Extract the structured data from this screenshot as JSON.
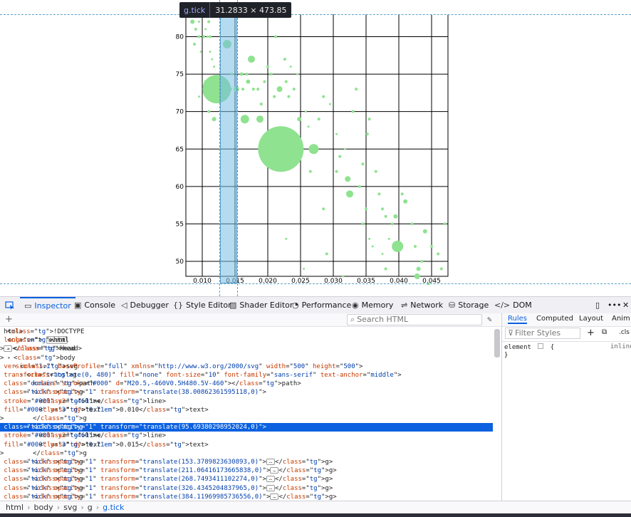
{
  "tooltip": {
    "tag": "g.tick",
    "dims": "31.2833 × 473.85"
  },
  "chart_data": {
    "type": "scatter",
    "x_ticks": [
      "0.010",
      "0.015",
      "0.020",
      "0.025",
      "0.030",
      "0.035",
      "0.040",
      "0.045"
    ],
    "y_ticks": [
      "50",
      "55",
      "60",
      "65",
      "70",
      "75",
      "80"
    ],
    "xlim": [
      0.0075,
      0.0475
    ],
    "ylim": [
      48,
      83
    ],
    "color": "#8fe28f",
    "points": [
      [
        0.0085,
        82,
        3
      ],
      [
        0.0088,
        83,
        2
      ],
      [
        0.0095,
        82,
        1.5
      ],
      [
        0.0105,
        81,
        1.5
      ],
      [
        0.011,
        82,
        2
      ],
      [
        0.009,
        81,
        2
      ],
      [
        0.0095,
        80,
        2
      ],
      [
        0.0102,
        80,
        2
      ],
      [
        0.0108,
        80,
        1.5
      ],
      [
        0.0112,
        80,
        2
      ],
      [
        0.0088,
        79,
        2
      ],
      [
        0.0098,
        78,
        1.5
      ],
      [
        0.0115,
        77,
        1.5
      ],
      [
        0.0112,
        78,
        1.5
      ],
      [
        0.0118,
        76,
        1.5
      ],
      [
        0.0095,
        72,
        1.5
      ],
      [
        0.0105,
        74,
        2
      ],
      [
        0.011,
        70,
        2
      ],
      [
        0.0118,
        69,
        3
      ],
      [
        0.0122,
        73,
        20
      ],
      [
        0.0138,
        79,
        6
      ],
      [
        0.0142,
        73,
        3
      ],
      [
        0.0152,
        73,
        4
      ],
      [
        0.0145,
        75,
        2
      ],
      [
        0.016,
        75,
        2.5
      ],
      [
        0.0168,
        75,
        2
      ],
      [
        0.0175,
        77,
        5
      ],
      [
        0.0162,
        73,
        2
      ],
      [
        0.017,
        74,
        3
      ],
      [
        0.0178,
        73,
        2
      ],
      [
        0.0185,
        73,
        2
      ],
      [
        0.0165,
        69,
        6
      ],
      [
        0.0188,
        69,
        5
      ],
      [
        0.019,
        71,
        2
      ],
      [
        0.0195,
        74,
        2
      ],
      [
        0.02,
        76,
        2
      ],
      [
        0.0205,
        75,
        2
      ],
      [
        0.021,
        72,
        2
      ],
      [
        0.0218,
        73,
        4
      ],
      [
        0.022,
        65,
        32
      ],
      [
        0.0228,
        74,
        2
      ],
      [
        0.0232,
        72,
        2
      ],
      [
        0.024,
        73,
        2
      ],
      [
        0.0212,
        80,
        2
      ],
      [
        0.0226,
        77,
        2
      ],
      [
        0.0235,
        76,
        1.5
      ],
      [
        0.0245,
        75,
        1.5
      ],
      [
        0.0248,
        69,
        3
      ],
      [
        0.025,
        64,
        1.5
      ],
      [
        0.0258,
        70,
        1.5
      ],
      [
        0.0262,
        68,
        1.5
      ],
      [
        0.0265,
        62,
        2
      ],
      [
        0.027,
        65,
        7
      ],
      [
        0.0278,
        69,
        2
      ],
      [
        0.0285,
        72,
        2
      ],
      [
        0.0295,
        71,
        1.5
      ],
      [
        0.0305,
        67,
        1.5
      ],
      [
        0.031,
        64,
        2
      ],
      [
        0.0318,
        65,
        1.5
      ],
      [
        0.0322,
        61,
        4
      ],
      [
        0.033,
        70,
        2
      ],
      [
        0.0335,
        73,
        2
      ],
      [
        0.0325,
        59,
        5
      ],
      [
        0.034,
        60,
        2
      ],
      [
        0.0345,
        55,
        2
      ],
      [
        0.035,
        57,
        2
      ],
      [
        0.0355,
        53,
        1.5
      ],
      [
        0.036,
        52,
        1.5
      ],
      [
        0.0365,
        62,
        2
      ],
      [
        0.037,
        59,
        2
      ],
      [
        0.0375,
        57,
        2
      ],
      [
        0.038,
        56,
        2
      ],
      [
        0.0385,
        53,
        1.5
      ],
      [
        0.039,
        55,
        2
      ],
      [
        0.0398,
        52,
        8
      ],
      [
        0.0405,
        59,
        2
      ],
      [
        0.041,
        58,
        3
      ],
      [
        0.042,
        55,
        2
      ],
      [
        0.0425,
        52,
        2
      ],
      [
        0.043,
        49,
        3
      ],
      [
        0.0435,
        50,
        2
      ],
      [
        0.044,
        54,
        3
      ],
      [
        0.0445,
        47,
        2
      ],
      [
        0.045,
        52,
        2
      ],
      [
        0.046,
        51,
        2
      ],
      [
        0.0465,
        49,
        2
      ],
      [
        0.047,
        55,
        2
      ],
      [
        0.0428,
        48,
        4
      ],
      [
        0.0395,
        56,
        3
      ],
      [
        0.0355,
        69,
        2
      ],
      [
        0.0352,
        67,
        2
      ],
      [
        0.0345,
        63,
        2
      ],
      [
        0.0305,
        62,
        2
      ],
      [
        0.0285,
        57,
        2
      ],
      [
        0.029,
        51,
        2
      ],
      [
        0.0255,
        49,
        1.5
      ],
      [
        0.0228,
        53,
        1.5
      ],
      [
        0.0315,
        48,
        1.5
      ],
      [
        0.038,
        49,
        2
      ],
      [
        0.0375,
        51,
        1.5
      ]
    ]
  },
  "toolbar": {
    "tabs": [
      {
        "label": "Inspector",
        "icon": "inspector-icon"
      },
      {
        "label": "Console",
        "icon": "console-icon"
      },
      {
        "label": "Debugger",
        "icon": "debugger-icon"
      },
      {
        "label": "Style Editor",
        "icon": "braces-icon"
      },
      {
        "label": "Shader Editor",
        "icon": "shader-icon"
      },
      {
        "label": "Performance",
        "icon": "performance-icon"
      },
      {
        "label": "Memory",
        "icon": "memory-icon"
      },
      {
        "label": "Network",
        "icon": "network-icon"
      },
      {
        "label": "Storage",
        "icon": "storage-icon"
      },
      {
        "label": "DOM",
        "icon": "dom-icon"
      }
    ]
  },
  "markup": {
    "search_placeholder": "Search HTML",
    "lines": [
      "<!DOCTYPE html>",
      "<html lang=\"en\">",
      "<head>",
      "<body>",
      "<svg version=\"1.1\" baseProfile=\"full\" xmlns=\"http://www.w3.org/2000/svg\" width=\"500\" height=\"500\">",
      "<g transform=\"translate(0, 480)\" fill=\"none\" font-size=\"10\" font-family=\"sans-serif\" text-anchor=\"middle\">",
      "<path class=\"domain\" stroke=\"#000\" d=\"M20.5,-460V0.5H480.5V-460\"></path>",
      "<g class=\"tick\" opacity=\"1\" transform=\"translate(38.00862361595118,0)\">",
      "<line stroke=\"#000\" y2=\"-460\"></line>",
      "<text fill=\"#000\" y=\"3\" dy=\"0.71em\">0.010</text>",
      "</g>",
      "<g class=\"tick\" opacity=\"1\" transform=\"translate(95.69380298952024,0)\">",
      "<line stroke=\"#000\" y2=\"-460\"></line>",
      "<text fill=\"#000\" y=\"3\" dy=\"0.71em\">0.015</text>",
      "</g>",
      "<g class=\"tick\" opacity=\"1\" transform=\"translate(153.3789823630893,0)\">",
      "<g class=\"tick\" opacity=\"1\" transform=\"translate(211.06416173665838,0)\">",
      "<g class=\"tick\" opacity=\"1\" transform=\"translate(268.7493411102274,0)\">",
      "<g class=\"tick\" opacity=\"1\" transform=\"translate(326.4345204837965,0)\">",
      "<g class=\"tick\" opacity=\"1\" transform=\"translate(384.11969985736556,0)\">"
    ],
    "event_badge": "event"
  },
  "rules": {
    "tabs": [
      "Rules",
      "Computed",
      "Layout",
      "Anim"
    ],
    "filter_placeholder": "Filter Styles",
    "cls_label": ".cls",
    "element_rule": "element",
    "open_brace": "{",
    "close_brace": "}",
    "inline_label": "inline"
  },
  "breadcrumb": [
    "html",
    "body",
    "svg",
    "g",
    "g.tick"
  ]
}
